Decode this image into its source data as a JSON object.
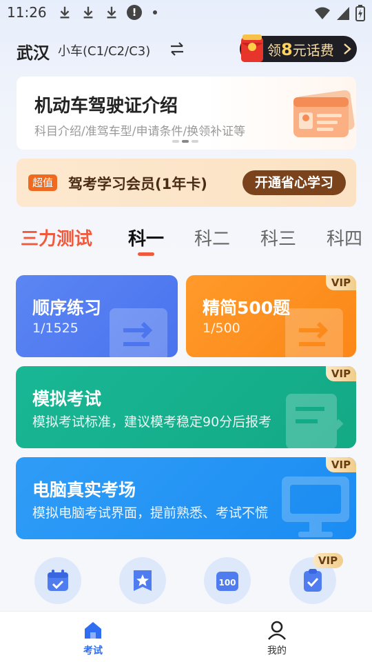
{
  "status_bar": {
    "time": "11:26",
    "icons": [
      "download-icon",
      "download-icon",
      "download-icon",
      "alert-icon",
      "dot",
      "wifi-icon",
      "signal-icon",
      "battery-icon"
    ]
  },
  "header": {
    "city": "武汉",
    "car_type": "小车(C1/C2/C3)",
    "switch_icon": "swap-icon",
    "reward": {
      "prefix": "领",
      "amount": "8",
      "suffix": "元话费"
    }
  },
  "banner": {
    "title": "机动车驾驶证介绍",
    "subtitle": "科目介绍/准驾车型/申请条件/换领补证等",
    "page_count": 3,
    "active_page": 2
  },
  "member": {
    "tag": "超值",
    "title": "驾考学习会员(1年卡)",
    "button": "开通省心学习"
  },
  "tabs": [
    {
      "label": "三力测试"
    },
    {
      "label": "科一",
      "active": true
    },
    {
      "label": "科二"
    },
    {
      "label": "科三"
    },
    {
      "label": "科四"
    }
  ],
  "cards": {
    "sequential": {
      "title": "顺序练习",
      "sub": "1/1525"
    },
    "simplified": {
      "title": "精简500题",
      "sub": "1/500",
      "badge": "VIP"
    },
    "mock": {
      "title": "模拟考试",
      "sub": "模拟考试标准，建议模考稳定90分后报考",
      "badge": "VIP"
    },
    "computer": {
      "title": "电脑真实考场",
      "sub": "模拟电脑考试界面，提前熟悉、考试不慌",
      "badge": "VIP"
    }
  },
  "shortcuts": {
    "icons": [
      "calendar-check-icon",
      "star-bookmark-icon",
      "score-100-icon",
      "clipboard-check-icon"
    ],
    "badge": "VIP"
  },
  "bottom_nav": {
    "home": "考试",
    "mine": "我的"
  },
  "colors": {
    "accent": "#2f6df2",
    "sanli": "#ef5a3c",
    "seq_card": "#4a73ee",
    "orange_card": "#fb8717",
    "green_card": "#13a985",
    "blue_card": "#1b8cf2",
    "member_button": "#7b431c"
  }
}
